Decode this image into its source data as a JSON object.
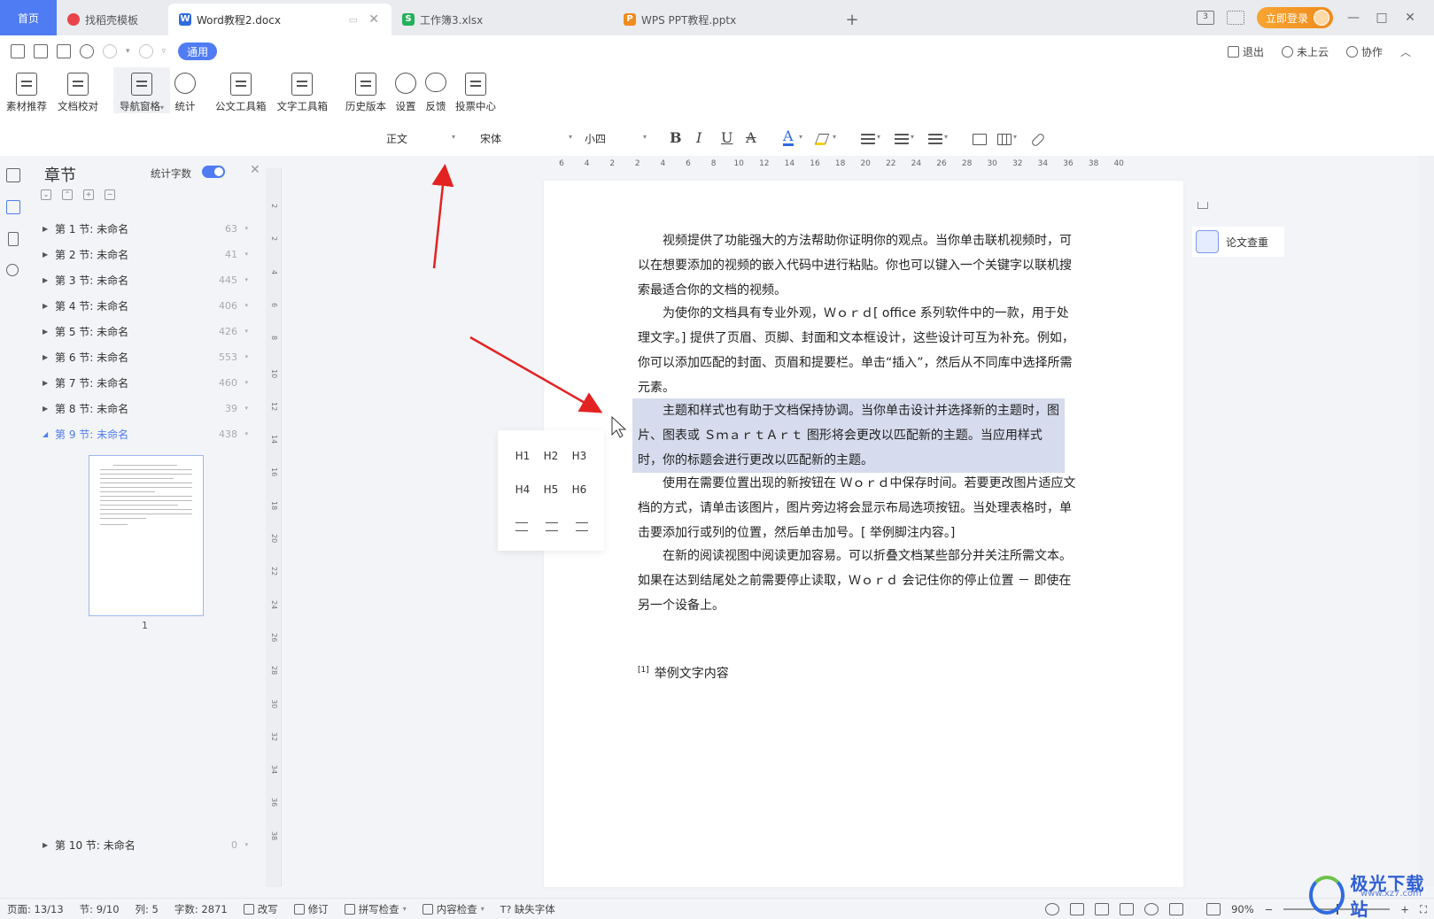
{
  "tabs": [
    {
      "label": "首页",
      "kind": "home"
    },
    {
      "label": "找稻壳模板",
      "badge_color": "#e8444b"
    },
    {
      "label": "Word教程2.docx",
      "badge": "W",
      "badge_color": "#2f6be0",
      "active": true
    },
    {
      "label": "工作簿3.xlsx",
      "badge": "S",
      "badge_color": "#25b15b"
    },
    {
      "label": "WPS PPT教程.pptx",
      "badge": "P",
      "badge_color": "#f08b1d"
    }
  ],
  "titlebar": {
    "login_label": "立即登录",
    "layout_badge": "3"
  },
  "quickbar": {
    "mode_label": "通用",
    "exit_label": "退出",
    "cloud_label": "未上云",
    "collab_label": "协作"
  },
  "ribbon": [
    {
      "label": "素材推荐",
      "icon": "star-doc-icon"
    },
    {
      "label": "文档校对",
      "icon": "proofread-icon"
    },
    {
      "label": "导航窗格",
      "icon": "nav-pane-icon",
      "has_dropdown": true
    },
    {
      "label": "统计",
      "icon": "pie-chart-icon"
    },
    {
      "label": "公文工具箱",
      "icon": "briefcase-icon"
    },
    {
      "label": "文字工具箱",
      "icon": "text-toolbox-icon"
    },
    {
      "label": "历史版本",
      "icon": "history-icon"
    },
    {
      "label": "设置",
      "icon": "gear-icon"
    },
    {
      "label": "反馈",
      "icon": "chat-bubble-icon"
    },
    {
      "label": "投票中心",
      "icon": "vote-icon"
    }
  ],
  "format": {
    "style": "正文",
    "font": "宋体",
    "size": "小四",
    "bold": "B",
    "italic": "I",
    "underline": "U",
    "strike": "A",
    "font_color": "A",
    "font_color_hex": "#2f6be0",
    "highlight_hex": "#f2d21b"
  },
  "nav": {
    "title": "章节",
    "stat_label": "统计字数",
    "items": [
      {
        "label": "第 1 节: 未命名",
        "count": "63"
      },
      {
        "label": "第 2 节: 未命名",
        "count": "41"
      },
      {
        "label": "第 3 节: 未命名",
        "count": "445"
      },
      {
        "label": "第 4 节: 未命名",
        "count": "406"
      },
      {
        "label": "第 5 节: 未命名",
        "count": "426"
      },
      {
        "label": "第 6 节: 未命名",
        "count": "553"
      },
      {
        "label": "第 7 节: 未命名",
        "count": "460"
      },
      {
        "label": "第 8 节: 未命名",
        "count": "39"
      },
      {
        "label": "第 9 节: 未命名",
        "count": "438",
        "selected": true
      }
    ],
    "page_number": "1",
    "last_item": {
      "label": "第 10 节: 未命名",
      "count": "0"
    }
  },
  "ruler": {
    "h_ticks": [
      "6",
      "4",
      "2",
      "2",
      "4",
      "6",
      "8",
      "10",
      "12",
      "14",
      "16",
      "18",
      "20",
      "22",
      "24",
      "26",
      "28",
      "30",
      "32",
      "34",
      "36",
      "38",
      "40"
    ],
    "v_ticks": [
      "2",
      "2",
      "4",
      "6",
      "8",
      "10",
      "12",
      "14",
      "16",
      "18",
      "20",
      "22",
      "24",
      "26",
      "28",
      "30",
      "32",
      "34",
      "36",
      "38"
    ]
  },
  "document": {
    "p1": "视频提供了功能强大的方法帮助你证明你的观点。当你单击联机视频时，可以在想要添加的视频的嵌入代码中进行粘贴。你也可以键入一个关键字以联机搜索最适合你的文档的视频。",
    "p2": "为使你的文档具有专业外观，Ｗｏｒｄ[ office 系列软件中的一款，用于处理文字。] 提供了页眉、页脚、封面和文本框设计，这些设计可互为补充。例如，你可以添加匹配的封面、页眉和提要栏。单击“插入”，然后从不同库中选择所需元素。",
    "p3": "主题和样式也有助于文档保持协调。当你单击设计并选择新的主题时，图片、图表或 ＳｍａｒｔＡｒｔ 图形将会更改以匹配新的主题。当应用样式时，你的标题会进行更改以匹配新的主题。",
    "p4": "使用在需要位置出现的新按钮在 Ｗｏｒｄ中保存时间。若要更改图片适应文档的方式，请单击该图片，图片旁边将会显示布局选项按钮。当处理表格时，单击要添加行或列的位置，然后单击加号。[ 举例脚注内容。]",
    "p5": "在新的阅读视图中阅读更加容易。可以折叠文档某些部分并关注所需文本。如果在达到结尾处之前需要停止读取，Ｗｏｒｄ 会记住你的停止位置 － 即使在另一个设备上。",
    "footnote_mark": "[1]",
    "footnote_text": "举例文字内容"
  },
  "heading_popup": {
    "h1": "H1",
    "h2": "H2",
    "h3": "H3",
    "h4": "H4",
    "h5": "H5",
    "h6": "H6"
  },
  "right_panel": {
    "check_label": "论文查重"
  },
  "status": {
    "page": "页面: 13/13",
    "section": "节: 9/10",
    "column": "列: 5",
    "words": "字数: 2871",
    "overwrite": "改写",
    "revise": "修订",
    "spellcheck": "拼写检查",
    "content_check": "内容检查",
    "missing_font": "缺失字体",
    "zoom": "90%"
  },
  "watermark": {
    "brand": "极光下载站",
    "url": "www.xz7.com"
  },
  "colors": {
    "accent": "#4f7cf2",
    "arrow": "#e32222",
    "highlight_bg": "#d6dced"
  }
}
